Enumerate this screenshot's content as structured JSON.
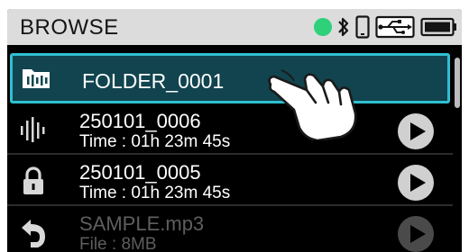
{
  "header": {
    "title": "BROWSE",
    "status_color": "#2fd07a"
  },
  "list": [
    {
      "name": "FOLDER_0001",
      "icon": "folder-audio-icon",
      "selected": true
    },
    {
      "name": "250101_0006",
      "sub": "Time : 01h 23m 45s",
      "icon": "waveform-icon",
      "action": "play-icon"
    },
    {
      "name": "250101_0005",
      "sub": "Time : 01h 23m 45s",
      "icon": "lock-icon",
      "action": "play-icon"
    },
    {
      "name": "SAMPLE.mp3",
      "sub": "File : 8MB",
      "icon": "undo-icon",
      "action": "play-icon",
      "dimmed": true
    }
  ],
  "colors": {
    "selection_fill": "#11444f",
    "selection_border": "#2fc0d0",
    "header_bg": "#dcdcdc"
  }
}
